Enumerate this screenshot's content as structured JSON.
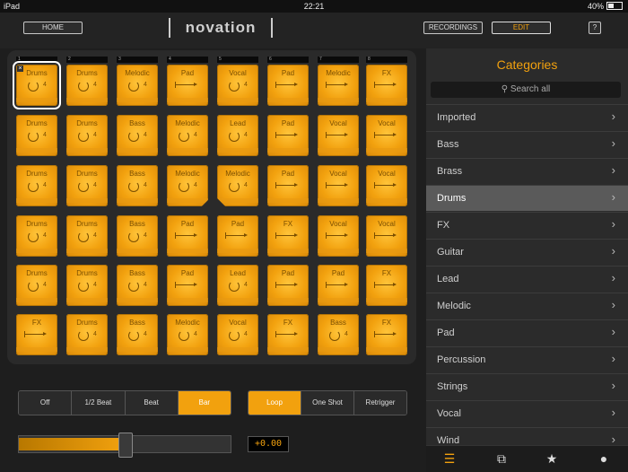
{
  "status": {
    "device": "iPad",
    "time": "22:21",
    "battery": "40%"
  },
  "header": {
    "home": "HOME",
    "logo": "novation",
    "recordings": "RECORDINGS",
    "edit": "EDIT",
    "help": "?"
  },
  "accent_color": "#f2a10e",
  "columns": [
    "1",
    "2",
    "3",
    "4",
    "5",
    "6",
    "7",
    "8"
  ],
  "pads": [
    [
      "Drums",
      "Drums",
      "Melodic",
      "Pad",
      "Vocal",
      "Pad",
      "Melodic",
      "FX"
    ],
    [
      "Drums",
      "Drums",
      "Bass",
      "Melodic",
      "Lead",
      "Pad",
      "Vocal",
      "Vocal"
    ],
    [
      "Drums",
      "Drums",
      "Bass",
      "Melodic",
      "Melodic",
      "Pad",
      "Vocal",
      "Vocal"
    ],
    [
      "Drums",
      "Drums",
      "Bass",
      "Pad",
      "Pad",
      "FX",
      "Vocal",
      "Vocal"
    ],
    [
      "Drums",
      "Drums",
      "Bass",
      "Pad",
      "Lead",
      "Pad",
      "Pad",
      "FX"
    ],
    [
      "FX",
      "Drums",
      "Bass",
      "Melodic",
      "Vocal",
      "FX",
      "Bass",
      "FX"
    ]
  ],
  "pad_number": "4",
  "selected_pad": "Drums",
  "quantise": {
    "options": [
      "Off",
      "1/2 Beat",
      "Beat",
      "Bar"
    ],
    "selected": "Bar"
  },
  "playmode": {
    "options": [
      "Loop",
      "One Shot",
      "Retrigger"
    ],
    "selected": "Loop"
  },
  "volume": {
    "level": 0.5,
    "value_text": "+0.00"
  },
  "categories": {
    "title": "Categories",
    "search_placeholder": "Search all",
    "items": [
      "Imported",
      "Bass",
      "Brass",
      "Drums",
      "FX",
      "Guitar",
      "Lead",
      "Melodic",
      "Pad",
      "Percussion",
      "Strings",
      "Vocal",
      "Wind"
    ],
    "active": "Drums"
  },
  "tabs": [
    "list-icon",
    "layers-icon",
    "star-icon",
    "user-icon"
  ]
}
